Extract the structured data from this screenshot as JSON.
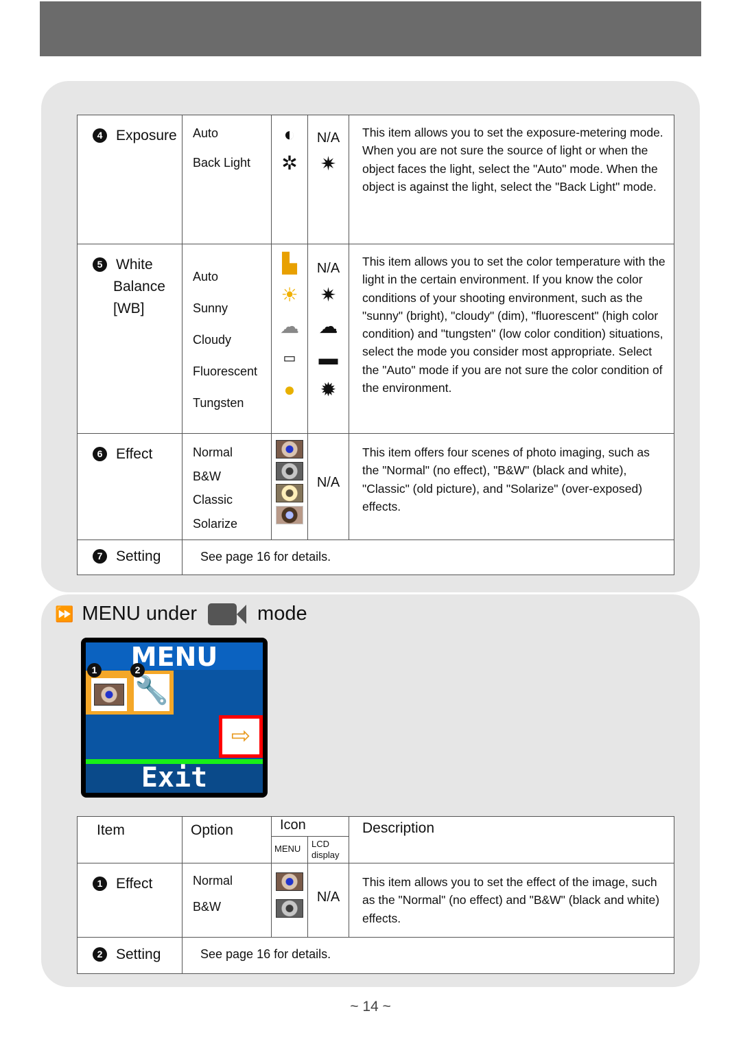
{
  "table1": {
    "rows": [
      {
        "num": "4",
        "item": [
          "Exposure"
        ],
        "options": [
          "Auto",
          "Back Light"
        ],
        "lcd": "N/A",
        "desc": "This item allows you to set the exposure-metering mode. When you are not sure the source of light or when the object faces the light, select the \"Auto\" mode. When the object is against the light, select the \"Back Light\" mode."
      },
      {
        "num": "5",
        "item": [
          "White",
          "Balance",
          "[WB]"
        ],
        "options": [
          "Auto",
          "Sunny",
          "Cloudy",
          "Fluorescent",
          "Tungsten"
        ],
        "lcd": "N/A",
        "desc": "This item allows you to set the color temperature with the light in the certain environment. If you know the color conditions of your shooting environment, such as the \"sunny\" (bright), \"cloudy\" (dim), \"fluorescent\" (high color condition) and \"tungsten\" (low color condition) situations, select the mode you consider most appropriate. Select the \"Auto\" mode if you are not sure the color condition of the environment."
      },
      {
        "num": "6",
        "item": [
          "Effect"
        ],
        "options": [
          "Normal",
          "B&W",
          "Classic",
          "Solarize"
        ],
        "lcd": "N/A",
        "desc": "This item offers four scenes of photo imaging, such as the \"Normal\" (no effect), \"B&W\" (black and white), \"Classic\" (old picture), and \"Solarize\" (over-exposed) effects."
      },
      {
        "num": "7",
        "item": [
          "Setting"
        ],
        "see": "See page 16 for details."
      }
    ]
  },
  "section": {
    "title_pre": "MENU under",
    "title_post": "mode",
    "icon": "video-camera-icon"
  },
  "screen": {
    "title": "MENU",
    "badges": [
      "1",
      "2"
    ],
    "exit": "Exit"
  },
  "table2": {
    "headers": {
      "item": "Item",
      "option": "Option",
      "icon": "Icon",
      "menu": "MENU",
      "lcd": "LCD display",
      "description": "Description"
    },
    "rows": [
      {
        "num": "1",
        "item": "Effect",
        "options": [
          "Normal",
          "B&W"
        ],
        "lcd": "N/A",
        "desc": "This item allows you to set the effect of the image, such as the \"Normal\" (no effect) and \"B&W\" (black and white) effects."
      },
      {
        "num": "2",
        "item": "Setting",
        "see": "See page 16 for details."
      }
    ]
  },
  "page_number": "~ 14 ~"
}
